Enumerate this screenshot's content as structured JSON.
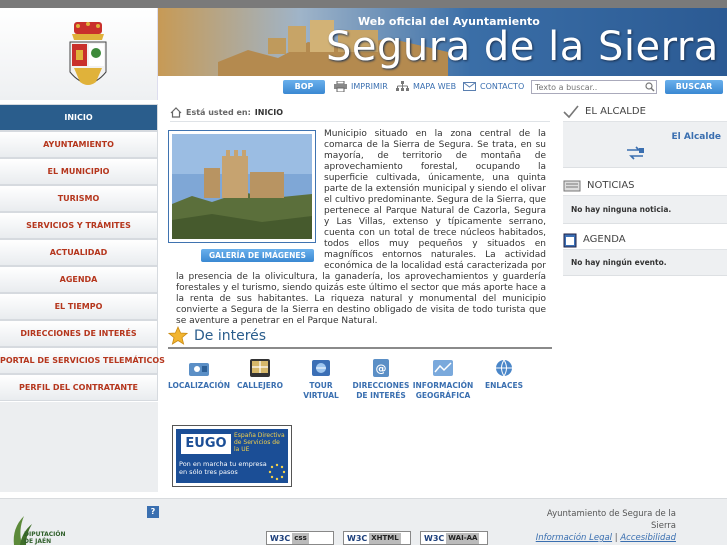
{
  "header": {
    "subtitle": "Web oficial del Ayuntamiento",
    "title": "Segura de la Sierra"
  },
  "toolbar": {
    "bop_label": "BOP",
    "print_label": "IMPRIMIR",
    "sitemap_label": "MAPA WEB",
    "contact_label": "CONTACTO",
    "search_placeholder": "Texto a buscar..",
    "search_button": "BUSCAR"
  },
  "sidebar": {
    "items": [
      {
        "label": "INICIO",
        "active": true
      },
      {
        "label": "AYUNTAMIENTO"
      },
      {
        "label": "EL MUNICIPIO"
      },
      {
        "label": "TURISMO"
      },
      {
        "label": "SERVICIOS Y TRÁMITES"
      },
      {
        "label": "ACTUALIDAD"
      },
      {
        "label": "AGENDA"
      },
      {
        "label": "EL TIEMPO"
      },
      {
        "label": "DIRECCIONES DE INTERÉS"
      },
      {
        "label": "PORTAL DE SERVICIOS TELEMÁTICOS"
      },
      {
        "label": "PERFIL DEL CONTRATANTE"
      }
    ]
  },
  "breadcrumb": {
    "label": "Está usted en:",
    "current": "INICIO"
  },
  "main": {
    "gallery_button": "GALERÍA DE IMÁGENES",
    "intro": "Municipio situado en la zona central de la comarca de la Sierra de Segura. Se trata, en su mayoría, de territorio de montaña de aprovechamiento forestal, ocupando la superficie cultivada, únicamente, una quinta parte de la extensión municipal y siendo el olivar el cultivo predominante. Segura de la Sierra, que pertenece al Parque Natural de Cazorla, Segura y Las Villas, extenso y típicamente serrano, cuenta con un total de trece núcleos habitados, todos ellos muy pequeños y situados en magníficos entornos naturales. La actividad económica de la localidad está caracterizada por la presencia de la olivicultura, la ganadería, los aprovechamientos y guardería forestales y el turismo, siendo quizás este último el sector que más aporte hace a la renta de sus habitantes. La riqueza natural y monumental del municipio convierte a Segura de la Sierra en destino obligado de visita de todo turista que se aventure a penetrar en el Parque Natural.",
    "interes_title": "De interés",
    "interes": [
      {
        "label": "LOCALIZACIÓN"
      },
      {
        "label": "CALLEJERO"
      },
      {
        "label": "TOUR VIRTUAL"
      },
      {
        "label": "DIRECCIONES DE INTERÉS"
      },
      {
        "label": "INFORMACIÓN GEOGRÁFICA"
      },
      {
        "label": "ENLACES"
      }
    ],
    "eugo": {
      "logo": "EUGO",
      "right": "España Directiva de Servicios de la UE",
      "bottom": "Pon en marcha tu empresa en sólo tres pasos"
    }
  },
  "right": {
    "alcalde_title": "EL ALCALDE",
    "alcalde_link": "El Alcalde",
    "noticias_title": "NOTICIAS",
    "noticias_empty": "No hay ninguna noticia.",
    "agenda_title": "AGENDA",
    "agenda_empty": "No hay ningún evento."
  },
  "footer": {
    "org": "Ayuntamiento de Segura de la Sierra",
    "legal": "Información Legal",
    "sep": "|",
    "access": "Accesibilidad",
    "help": "?",
    "dip_line1": "DIPUTACIÓN",
    "dip_line2": "DE JAÉN",
    "badges": [
      {
        "w3c": "W3C",
        "tag": "css"
      },
      {
        "w3c": "W3C",
        "tag": "XHTML"
      },
      {
        "w3c": "W3C",
        "tag": "WAI-AA"
      }
    ]
  },
  "colors": {
    "accent": "#2a5d8c",
    "nav_text": "#b5361d",
    "link": "#3a6fb0"
  }
}
